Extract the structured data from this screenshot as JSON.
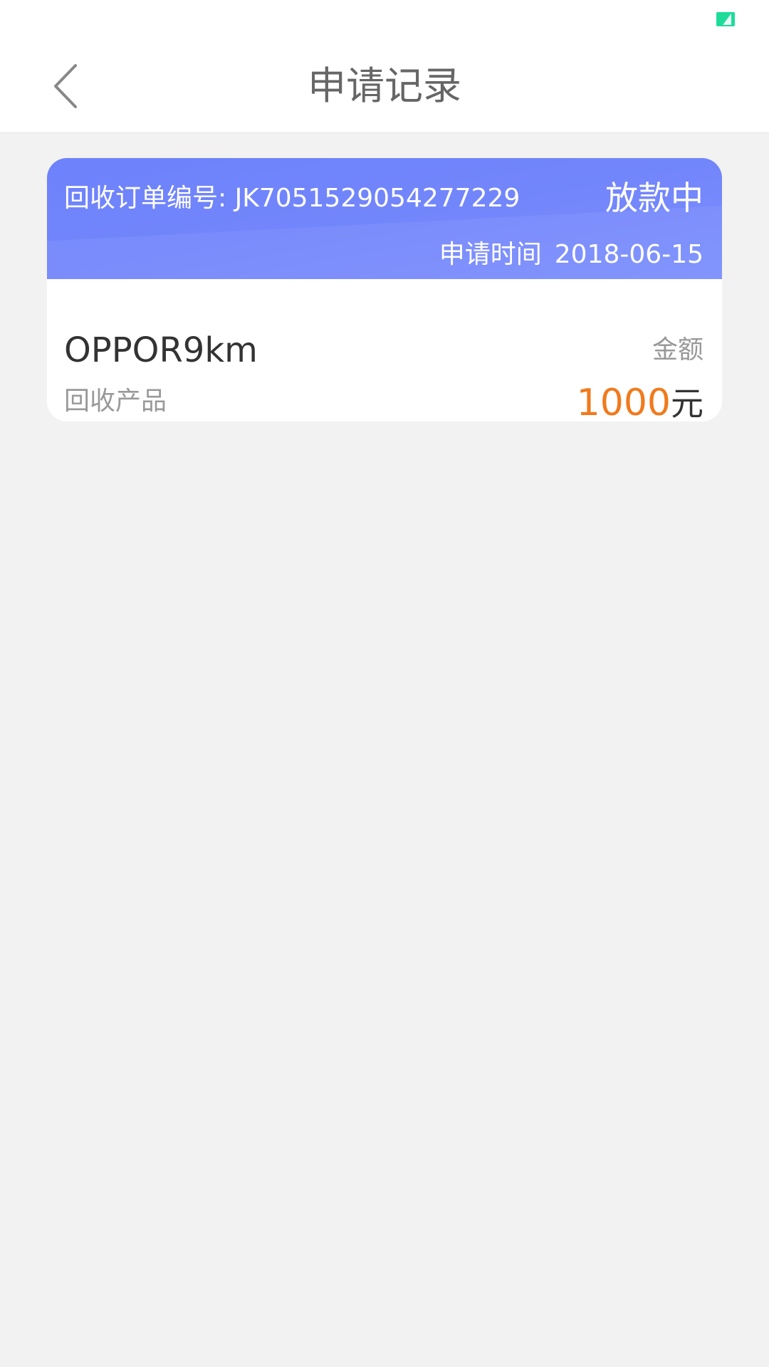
{
  "status_bar": {
    "battery_icon": "battery-charging-icon",
    "battery_color": "#1ddc9a"
  },
  "nav": {
    "back_icon": "chevron-left-icon",
    "title": "申请记录"
  },
  "records": [
    {
      "order_no_label": "回收订单编号:",
      "order_no": "JK7051529054277229",
      "status": "放款中",
      "apply_time_label": "申请时间",
      "apply_time": "2018-06-15",
      "product_name": "OPPOR9km",
      "product_label": "回收产品",
      "amount_label": "金额",
      "amount_value": "1000",
      "amount_unit": "元"
    }
  ],
  "colors": {
    "header_gradient_start": "#6d82fb",
    "header_gradient_end": "#7b8ffd",
    "amount_accent": "#f07a1c",
    "page_background": "#f2f2f2"
  }
}
